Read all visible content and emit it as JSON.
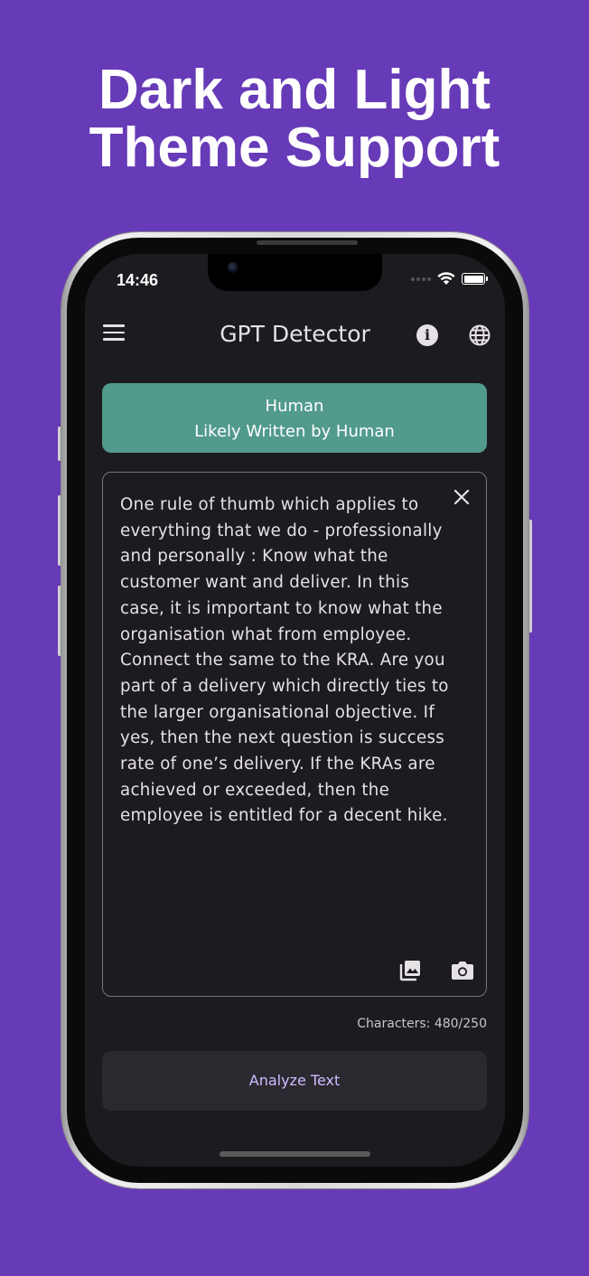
{
  "promo": {
    "title_line1": "Dark and Light",
    "title_line2": "Theme Support"
  },
  "status_bar": {
    "time": "14:46"
  },
  "app_bar": {
    "title": "GPT Detector",
    "icons": [
      "menu-icon",
      "info-icon",
      "globe-icon"
    ]
  },
  "result": {
    "label": "Human",
    "description": "Likely Written by Human",
    "color": "#519a8c"
  },
  "input": {
    "text": "One rule of thumb which applies to everything that we do - professionally and personally : Know what the customer want and deliver. In this case, it is important to know what the organisation what from employee. Connect the same to the KRA. Are you part of a delivery which directly ties to the larger organisational objective. If yes, then the next question is success rate of one’s delivery. If the KRAs are achieved or exceeded, then the employee is entitled for a decent hike.",
    "icons": [
      "close-icon",
      "gallery-icon",
      "camera-icon"
    ]
  },
  "character_count": "Characters: 480/250",
  "analyze_button": {
    "label": "Analyze Text"
  },
  "colors": {
    "background": "#673ab7",
    "screen": "#1c1b1f",
    "accent": "#d0bcff"
  }
}
